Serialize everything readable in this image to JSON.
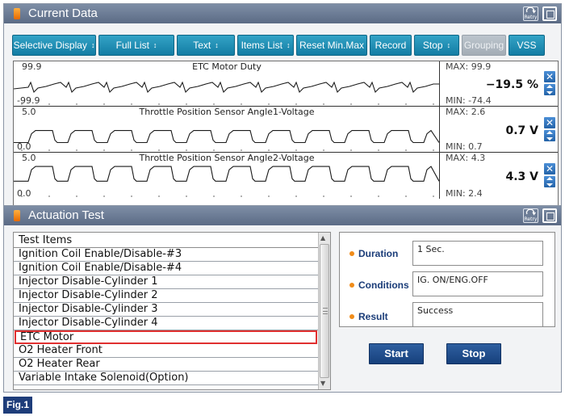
{
  "current_data": {
    "title": "Current Data",
    "retry_label": "Retry",
    "toolbar": [
      {
        "label": "Selective Display",
        "updown": true,
        "disabled": false
      },
      {
        "label": "Full List",
        "updown": true,
        "disabled": false
      },
      {
        "label": "Text",
        "updown": true,
        "disabled": false
      },
      {
        "label": "Items List",
        "updown": true,
        "disabled": false
      },
      {
        "label": "Reset Min.Max",
        "updown": false,
        "disabled": false
      },
      {
        "label": "Record",
        "updown": false,
        "disabled": false
      },
      {
        "label": "Stop",
        "updown": true,
        "disabled": false
      },
      {
        "label": "Grouping",
        "updown": false,
        "disabled": true
      },
      {
        "label": "VSS",
        "updown": false,
        "disabled": false
      }
    ],
    "graphs": [
      {
        "title": "ETC Motor Duty",
        "y_max": "99.9",
        "y_min": "-99.9",
        "max": "MAX: 99.9",
        "min": "MIN: -74.4",
        "value": "−19.5 %",
        "signal": "duty"
      },
      {
        "title": "Throttle Position Sensor Angle1-Voltage",
        "y_max": "5.0",
        "y_min": "0.0",
        "max": "MAX: 2.6",
        "min": "MIN: 0.7",
        "value": "0.7 V",
        "signal": "square_low"
      },
      {
        "title": "Throttle Position Sensor Angle2-Voltage",
        "y_max": "5.0",
        "y_min": "0.0",
        "max": "MAX: 4.3",
        "min": "MIN: 2.4",
        "value": "4.3 V",
        "signal": "square_high"
      }
    ]
  },
  "actuation_test": {
    "title": "Actuation Test",
    "retry_label": "Retry",
    "list_header": "Test Items",
    "items": [
      "Ignition Coil Enable/Disable-#3",
      "Ignition Coil Enable/Disable-#4",
      "Injector Disable-Cylinder 1",
      "Injector Disable-Cylinder 2",
      "Injector Disable-Cylinder 3",
      "Injector Disable-Cylinder 4",
      "ETC Motor",
      "O2 Heater Front",
      "O2 Heater Rear",
      "Variable Intake Solenoid(Option)"
    ],
    "selected_index": 6,
    "duration_label": "Duration",
    "duration_value": "1 Sec.",
    "conditions_label": "Conditions",
    "conditions_value": "IG. ON/ENG.OFF",
    "result_label": "Result",
    "result_value": "Success",
    "start_label": "Start",
    "stop_label": "Stop"
  },
  "figure_label": "Fig.1",
  "colors": {
    "title_bar": "#6a7a94",
    "toolbar_button": "#1d8cb4",
    "disabled_button": "#b0b8c0",
    "action_button": "#1f4d8c",
    "selection_border": "#e03030",
    "bullet": "#f08c1a"
  }
}
